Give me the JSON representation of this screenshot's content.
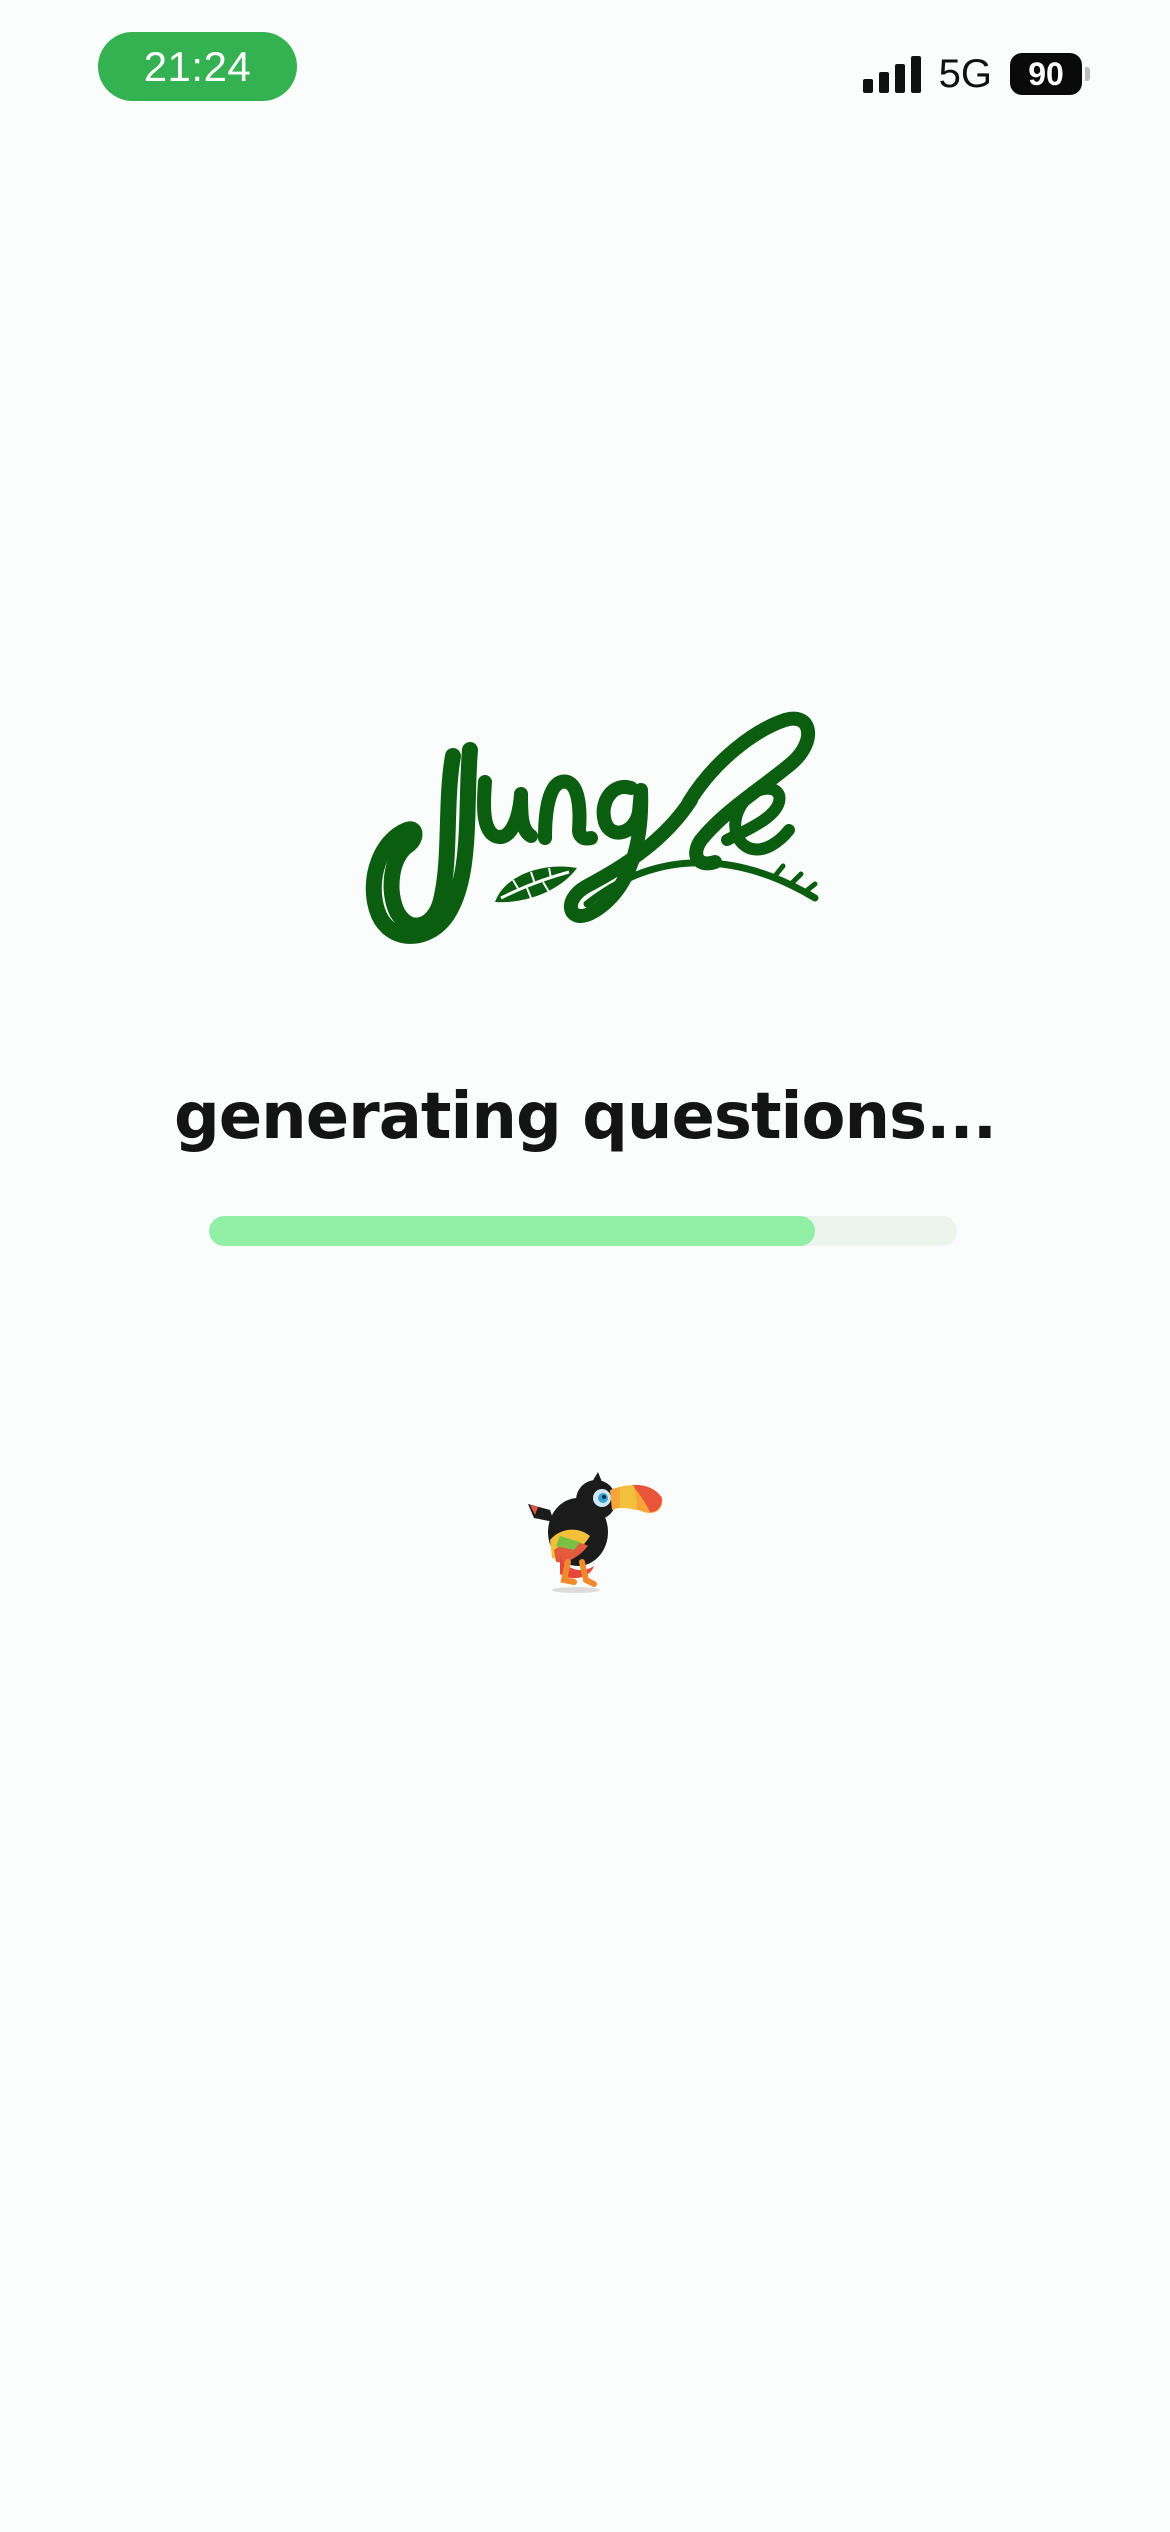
{
  "status_bar": {
    "time": "21:24",
    "network": "5G",
    "battery": "90",
    "signal_icon": "cellular-signal-icon",
    "battery_icon": "battery-icon"
  },
  "brand": {
    "logo_text": "Jungle",
    "logo_color": "#0b5d10"
  },
  "loading": {
    "title": "generating questions...",
    "progress": 0.81
  },
  "mascot": {
    "icon": "toucan-mascot-icon"
  },
  "colors": {
    "time_pill": "#34b251",
    "progress_fill": "#92efa6",
    "progress_track": "#edf4ee",
    "background": "#fbfdfc"
  }
}
